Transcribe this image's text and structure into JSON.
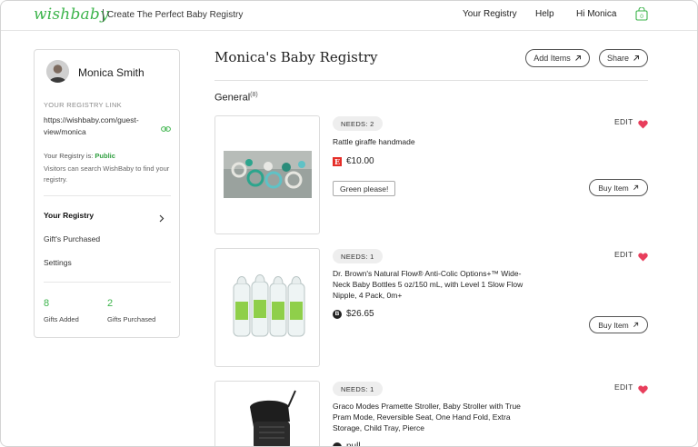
{
  "header": {
    "logo": "wishbaby",
    "tagline": "Create The Perfect Baby Registry",
    "nav": [
      "Your Registry",
      "Help",
      "Hi Monica"
    ],
    "cart_count": "0",
    "brand_color": "#3cb44b"
  },
  "sidebar": {
    "name": "Monica Smith",
    "link_heading": "YOUR REGISTRY LINK",
    "link": "https://wishbaby.com/guest-view/monica",
    "status_prefix": "Your Registry is:",
    "status_value": "Public",
    "visitors_note": "Visitors can search WishBaby to find your registry.",
    "menu": [
      {
        "label": "Your Registry"
      },
      {
        "label": "Gift's Purchased"
      },
      {
        "label": "Settings"
      }
    ],
    "stats": [
      {
        "value": "8",
        "label": "Gifts Added"
      },
      {
        "value": "2",
        "label": "Gifts Purchased"
      }
    ]
  },
  "main": {
    "title": "Monica's Baby Registry",
    "add_items": "Add Items",
    "share": "Share",
    "section": "General",
    "section_count": "(8)",
    "items": [
      {
        "needs": "NEEDS: 2",
        "name": "Rattle giraffe handmade",
        "store_icon": "E",
        "price": "€10.00",
        "note": "Green please!",
        "edit": "EDIT",
        "buy": "Buy Item"
      },
      {
        "needs": "NEEDS: 1",
        "name": "Dr. Brown's Natural Flow® Anti-Colic Options+™ Wide-Neck Baby Bottles 5 oz/150 mL, with Level 1 Slow Flow Nipple, 4 Pack, 0m+",
        "store_icon": "B",
        "price": "$26.65",
        "edit": "EDIT",
        "buy": "Buy Item"
      },
      {
        "needs": "NEEDS: 1",
        "name": "Graco Modes Pramette Stroller, Baby Stroller with True Pram Mode, Reversible Seat, One Hand Fold, Extra Storage, Child Tray, Pierce",
        "price": "null",
        "edit": "EDIT"
      }
    ]
  }
}
